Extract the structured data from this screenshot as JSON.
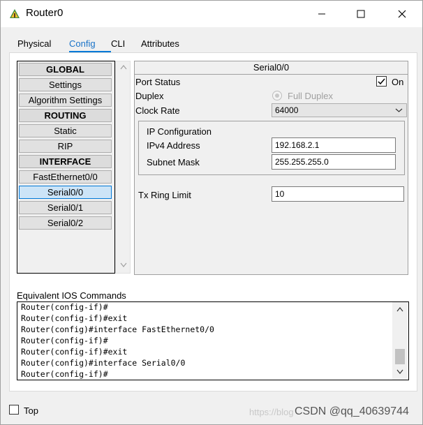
{
  "window": {
    "title": "Router0",
    "min_glyph": "–",
    "max_glyph": "☐",
    "close_glyph": "✕"
  },
  "tabs": [
    {
      "label": "Physical",
      "active": false
    },
    {
      "label": "Config",
      "active": true
    },
    {
      "label": "CLI",
      "active": false
    },
    {
      "label": "Attributes",
      "active": false
    }
  ],
  "sidebar": {
    "items": [
      {
        "label": "GLOBAL",
        "type": "header"
      },
      {
        "label": "Settings",
        "type": "item"
      },
      {
        "label": "Algorithm Settings",
        "type": "item"
      },
      {
        "label": "ROUTING",
        "type": "header"
      },
      {
        "label": "Static",
        "type": "item"
      },
      {
        "label": "RIP",
        "type": "item"
      },
      {
        "label": "INTERFACE",
        "type": "header"
      },
      {
        "label": "FastEthernet0/0",
        "type": "item"
      },
      {
        "label": "Serial0/0",
        "type": "item",
        "selected": true
      },
      {
        "label": "Serial0/1",
        "type": "item"
      },
      {
        "label": "Serial0/2",
        "type": "item"
      }
    ]
  },
  "panel": {
    "title": "Serial0/0",
    "port_status_label": "Port Status",
    "port_status_on_label": "On",
    "port_status_checked": true,
    "duplex_label": "Duplex",
    "duplex_value": "Full Duplex",
    "clock_rate_label": "Clock Rate",
    "clock_rate_value": "64000",
    "ip_config_title": "IP Configuration",
    "ipv4_label": "IPv4 Address",
    "ipv4_value": "192.168.2.1",
    "subnet_label": "Subnet Mask",
    "subnet_value": "255.255.255.0",
    "tx_ring_label": "Tx Ring Limit",
    "tx_ring_value": "10"
  },
  "ios": {
    "label": "Equivalent IOS Commands",
    "lines": [
      "Router(config-if)#",
      "Router(config-if)#exit",
      "Router(config)#interface FastEthernet0/0",
      "Router(config-if)#",
      "Router(config-if)#exit",
      "Router(config)#interface Serial0/0",
      "Router(config-if)#"
    ]
  },
  "footer": {
    "top_label": "Top",
    "top_checked": false,
    "watermark_faded": "https://blog",
    "watermark": "CSDN @qq_40639744"
  },
  "colors": {
    "accent": "#0078d7",
    "selected_bg": "#cce4f7"
  }
}
